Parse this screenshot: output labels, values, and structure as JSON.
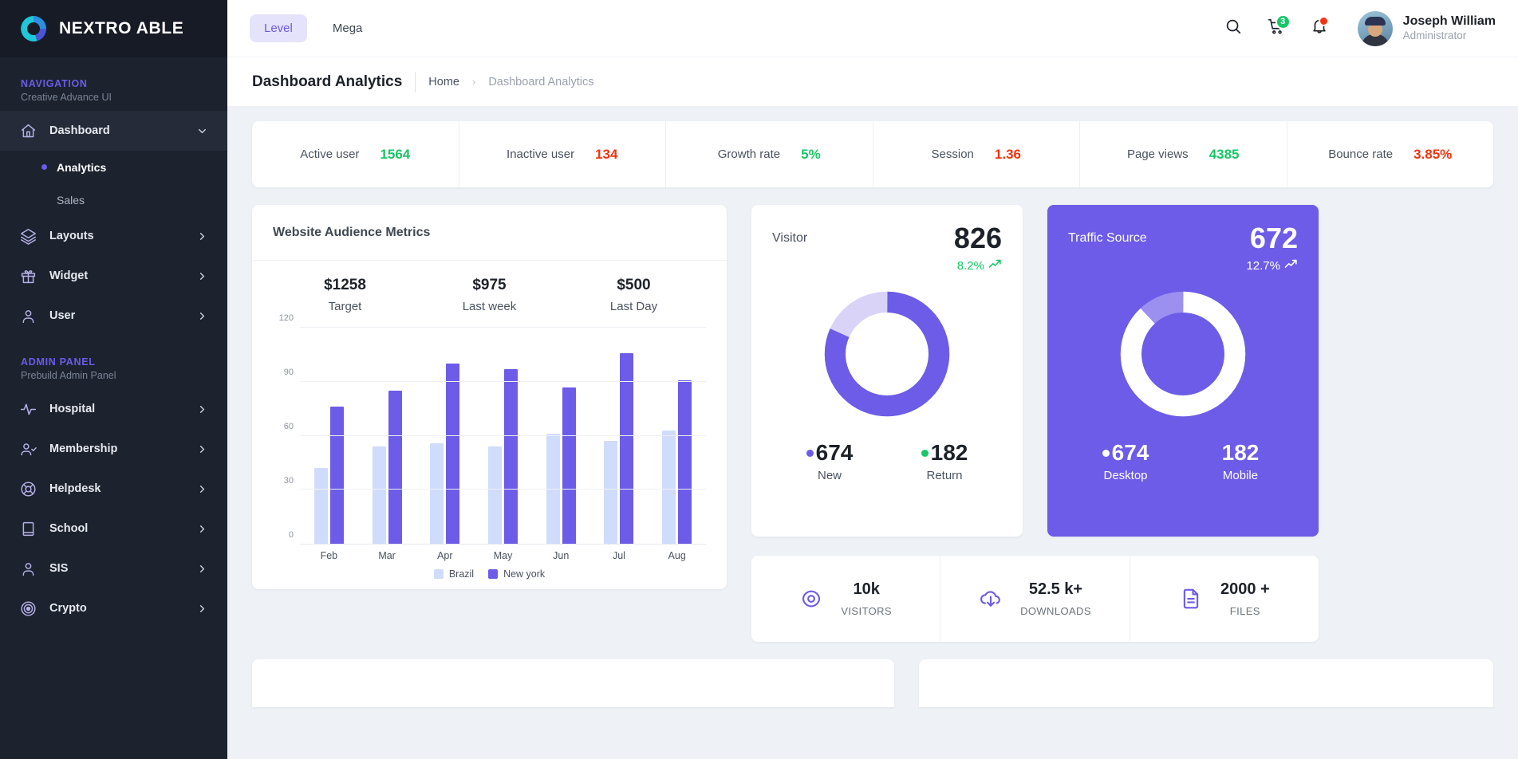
{
  "sidebar": {
    "brand": {
      "name": "NEXTRO ABLE",
      "logo_icon": "donut-logo-icon",
      "color": "#22b9d4"
    },
    "caption_nav": {
      "title": "NAVIGATION",
      "subtitle": "Creative Advance UI"
    },
    "caption_admin": {
      "title": "ADMIN PANEL",
      "subtitle": "Prebuild Admin Panel"
    },
    "nav_items": [
      {
        "label": "Dashboard",
        "icon": "home-icon",
        "arrow": "chevron-down-icon",
        "active": true
      },
      {
        "label": "Layouts",
        "icon": "layers-icon",
        "arrow": "chevron-right-icon",
        "active": false
      },
      {
        "label": "Widget",
        "icon": "gift-icon",
        "arrow": "chevron-right-icon",
        "active": false
      },
      {
        "label": "User",
        "icon": "user-icon",
        "arrow": "chevron-right-icon",
        "active": false
      }
    ],
    "sub_items": [
      {
        "label": "Analytics",
        "active": true
      },
      {
        "label": "Sales",
        "active": false
      }
    ],
    "admin_items": [
      {
        "label": "Hospital",
        "icon": "activity-icon",
        "arrow": "chevron-right-icon"
      },
      {
        "label": "Membership",
        "icon": "user-check-icon",
        "arrow": "chevron-right-icon"
      },
      {
        "label": "Helpdesk",
        "icon": "lifebuoy-icon",
        "arrow": "chevron-right-icon"
      },
      {
        "label": "School",
        "icon": "book-icon",
        "arrow": "chevron-right-icon"
      },
      {
        "label": "SIS",
        "icon": "user-icon",
        "arrow": "chevron-right-icon"
      },
      {
        "label": "Crypto",
        "icon": "target-icon",
        "arrow": "chevron-right-icon"
      }
    ]
  },
  "topbar": {
    "tabs": [
      {
        "label": "Level",
        "active": true
      },
      {
        "label": "Mega",
        "active": false
      }
    ],
    "search_icon": "search-icon",
    "cart_icon": "cart-icon",
    "cart_badge": "3",
    "bell_icon": "bell-icon",
    "user": {
      "name": "Joseph William",
      "role": "Administrator"
    }
  },
  "breadcrumb": {
    "title": "Dashboard Analytics",
    "home": "Home",
    "separator": "›",
    "current": "Dashboard Analytics"
  },
  "stats": [
    {
      "label": "Active user",
      "value": "1564",
      "color": "#17c666"
    },
    {
      "label": "Inactive user",
      "value": "134",
      "color": "#f4330f"
    },
    {
      "label": "Growth rate",
      "value": "5%",
      "color": "#17c666"
    },
    {
      "label": "Session",
      "value": "1.36",
      "color": "#f4330f"
    },
    {
      "label": "Page views",
      "value": "4385",
      "color": "#17c666"
    },
    {
      "label": "Bounce rate",
      "value": "3.85%",
      "color": "#f4330f"
    }
  ],
  "audience_card": {
    "title": "Website Audience Metrics",
    "kpis": [
      {
        "value": "$1258",
        "label": "Target"
      },
      {
        "value": "$975",
        "label": "Last week"
      },
      {
        "value": "$500",
        "label": "Last Day"
      }
    ]
  },
  "chart_data": {
    "type": "bar",
    "title": "Website Audience Metrics",
    "categories": [
      "Feb",
      "Mar",
      "Apr",
      "May",
      "Jun",
      "Jul",
      "Aug"
    ],
    "series": [
      {
        "name": "Brazil",
        "color": "#cfdcfb",
        "values": [
          42,
          54,
          56,
          54,
          61,
          57,
          63
        ]
      },
      {
        "name": "New york",
        "color": "#6c5ce7",
        "values": [
          76,
          85,
          100,
          97,
          87,
          106,
          91
        ]
      }
    ],
    "xlabel": "",
    "ylabel": "",
    "ylim": [
      0,
      120
    ],
    "yticks": [
      0,
      30,
      60,
      90,
      120
    ],
    "grid": true,
    "legend_position": "bottom"
  },
  "visitor_card": {
    "title": "Visitor",
    "total": "826",
    "delta": "8.2%",
    "delta_icon": "trend-up-icon",
    "delta_color": "#17c666",
    "donut": {
      "primary_pct": 81.6,
      "primary_color": "#6c5ce7",
      "secondary_color": "#d8d3f7"
    },
    "legend": [
      {
        "value": "674",
        "label": "New",
        "color": "#6c5ce7"
      },
      {
        "value": "182",
        "label": "Return",
        "color": "#17c666"
      }
    ]
  },
  "traffic_card": {
    "title": "Traffic Source",
    "total": "672",
    "delta": "12.7%",
    "delta_icon": "trend-up-icon",
    "background": "#6c5ce7",
    "donut": {
      "primary_pct": 88,
      "primary_color": "#ffffff",
      "secondary_color": "#9b8ff0"
    },
    "legend": [
      {
        "value": "674",
        "label": "Desktop",
        "color": "#ffffff",
        "show_dot": true
      },
      {
        "value": "182",
        "label": "Mobile",
        "color": "#ffffff",
        "show_dot": false
      }
    ]
  },
  "metrics": [
    {
      "icon": "eye-icon",
      "value": "10k",
      "label": "VISITORS"
    },
    {
      "icon": "download-icon",
      "value": "52.5 k+",
      "label": "DOWNLOADS"
    },
    {
      "icon": "file-icon",
      "value": "2000 +",
      "label": "FILES"
    }
  ]
}
